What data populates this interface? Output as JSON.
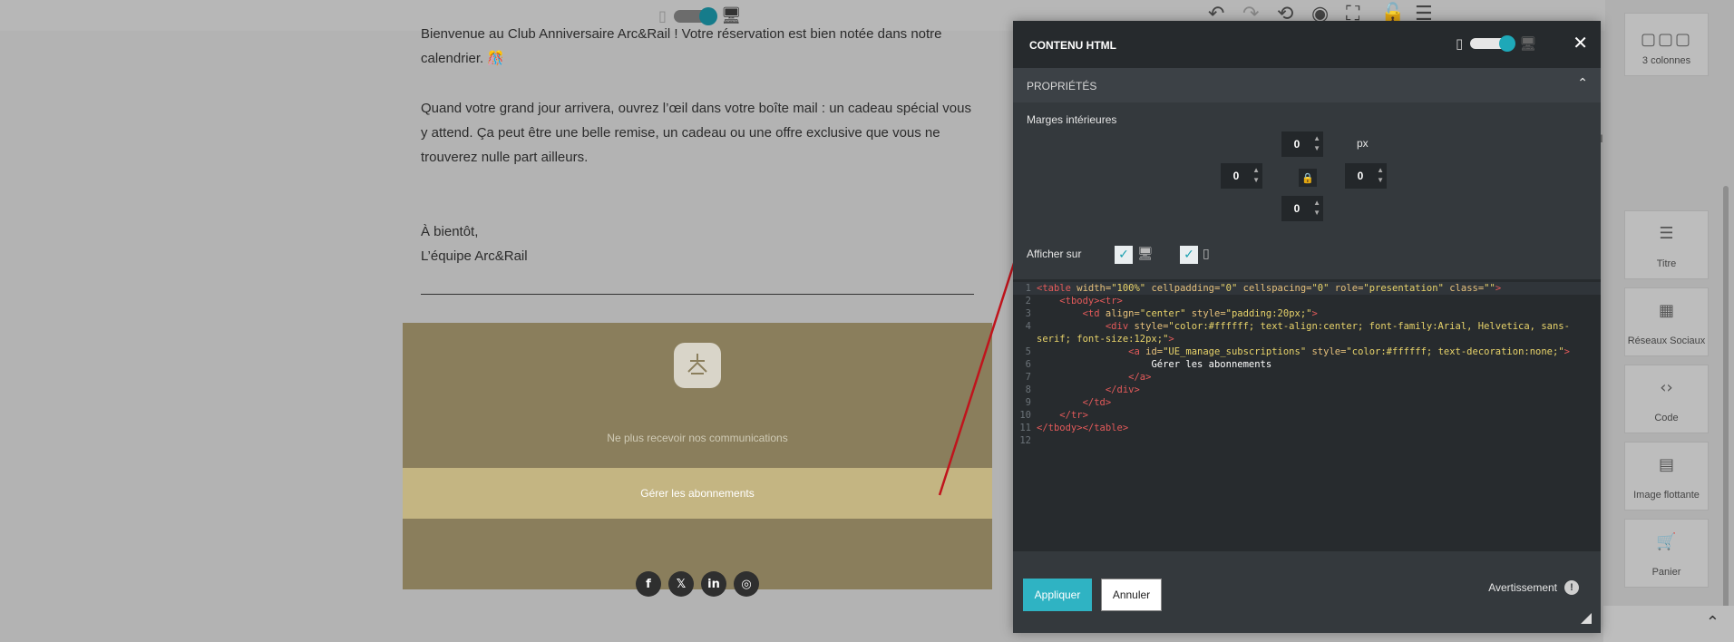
{
  "email": {
    "paragraph1": "Bienvenue au Club Anniversaire Arc&Rail ! Votre réservation est bien notée dans notre calendrier.  🎊",
    "paragraph2": "Quand votre grand jour arrivera, ouvrez l’œil dans votre boîte mail : un cadeau spécial vous y attend. Ça peut être une belle remise, un cadeau ou une offre exclusive que vous ne trouverez nulle part ailleurs.",
    "signoff_line1": "À bientôt,",
    "signoff_line2": "L’équipe Arc&Rail",
    "footer": {
      "unsubscribe_text": "Ne plus recevoir nos communications",
      "manage_link": "Gérer les abonnements",
      "socials": [
        "facebook",
        "x",
        "linkedin",
        "instagram"
      ],
      "background": "#8a7e5c",
      "band_color": "#c4b582"
    }
  },
  "sidebar": {
    "blocks": [
      {
        "label": "3 colonnes",
        "icon": "columns-icon"
      },
      {
        "label": "Titre",
        "icon": "title-icon"
      },
      {
        "label": "Réseaux Sociaux",
        "icon": "social-icon"
      },
      {
        "label": "Code",
        "icon": "code-icon"
      },
      {
        "label": "Image flottante",
        "icon": "float-image-icon"
      },
      {
        "label": "Panier",
        "icon": "cart-icon"
      }
    ],
    "partial_label": "el"
  },
  "modal": {
    "title": "CONTENU HTML",
    "section_title": "PROPRIÉTÉS",
    "padding_label": "Marges intérieures",
    "padding_unit": "px",
    "padding": {
      "top": "0",
      "left": "0",
      "right": "0",
      "bottom": "0"
    },
    "display_label": "Afficher sur",
    "display_desktop": true,
    "display_mobile": true,
    "apply_label": "Appliquer",
    "cancel_label": "Annuler",
    "warning_label": "Avertissement",
    "accent": "#2fb3c3"
  },
  "code_lines": [
    {
      "n": "1",
      "html": "<span class='tg'>&lt;table</span> <span class='at'>width=</span><span class='st'>\"100%\"</span> <span class='at'>cellpadding=</span><span class='st'>\"0\"</span> <span class='at'>cellspacing=</span><span class='st'>\"0\"</span> <span class='at'>role=</span><span class='st'>\"presentation\"</span> <span class='at'>class=</span><span class='st'>\"\"</span><span class='tg'>&gt;</span>"
    },
    {
      "n": "2",
      "html": "    <span class='tg'>&lt;tbody&gt;&lt;tr&gt;</span>"
    },
    {
      "n": "3",
      "html": "        <span class='tg'>&lt;td</span> <span class='at'>align=</span><span class='st'>\"center\"</span> <span class='at'>style=</span><span class='st'>\"padding:20px;\"</span><span class='tg'>&gt;</span>"
    },
    {
      "n": "4",
      "html": "            <span class='tg'>&lt;div</span> <span class='at'>style=</span><span class='st'>\"color:#ffffff; text-align:center; font-family:Arial, Helvetica, sans-serif; font-size:12px;\"</span><span class='tg'>&gt;</span>"
    },
    {
      "n": "5",
      "html": "                <span class='tg'>&lt;a</span> <span class='at'>id=</span><span class='st'>\"UE_manage_subscriptions\"</span> <span class='at'>style=</span><span class='st'>\"color:#ffffff; text-decoration:none;\"</span><span class='tg'>&gt;</span>"
    },
    {
      "n": "6",
      "html": "                    <span class='tx'>Gérer les abonnements</span>"
    },
    {
      "n": "7",
      "html": "                <span class='tg'>&lt;/a&gt;</span>"
    },
    {
      "n": "8",
      "html": "            <span class='tg'>&lt;/div&gt;</span>"
    },
    {
      "n": "9",
      "html": "        <span class='tg'>&lt;/td&gt;</span>"
    },
    {
      "n": "10",
      "html": "    <span class='tg'>&lt;/tr&gt;</span>"
    },
    {
      "n": "11",
      "html": "<span class='tg'>&lt;/tbody&gt;&lt;/table&gt;</span>"
    },
    {
      "n": "12",
      "html": ""
    }
  ]
}
